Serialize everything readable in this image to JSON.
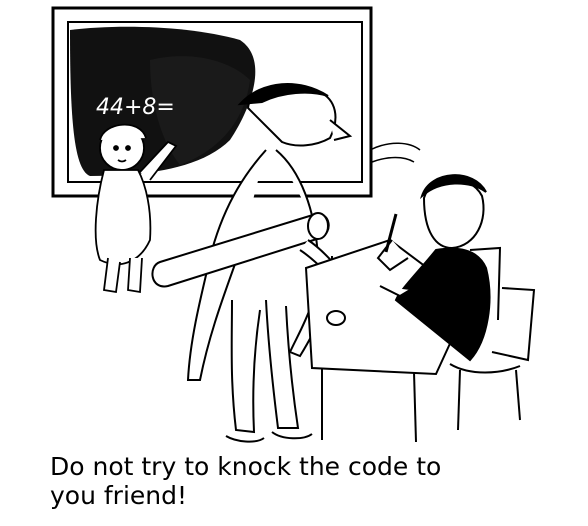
{
  "board": {
    "equation": "44+8="
  },
  "caption": {
    "line1": "Do not try to knock the code to",
    "line2": "you friend!"
  },
  "colors": {
    "ink": "#000000",
    "paper": "#ffffff",
    "blackboard": "#111111"
  }
}
